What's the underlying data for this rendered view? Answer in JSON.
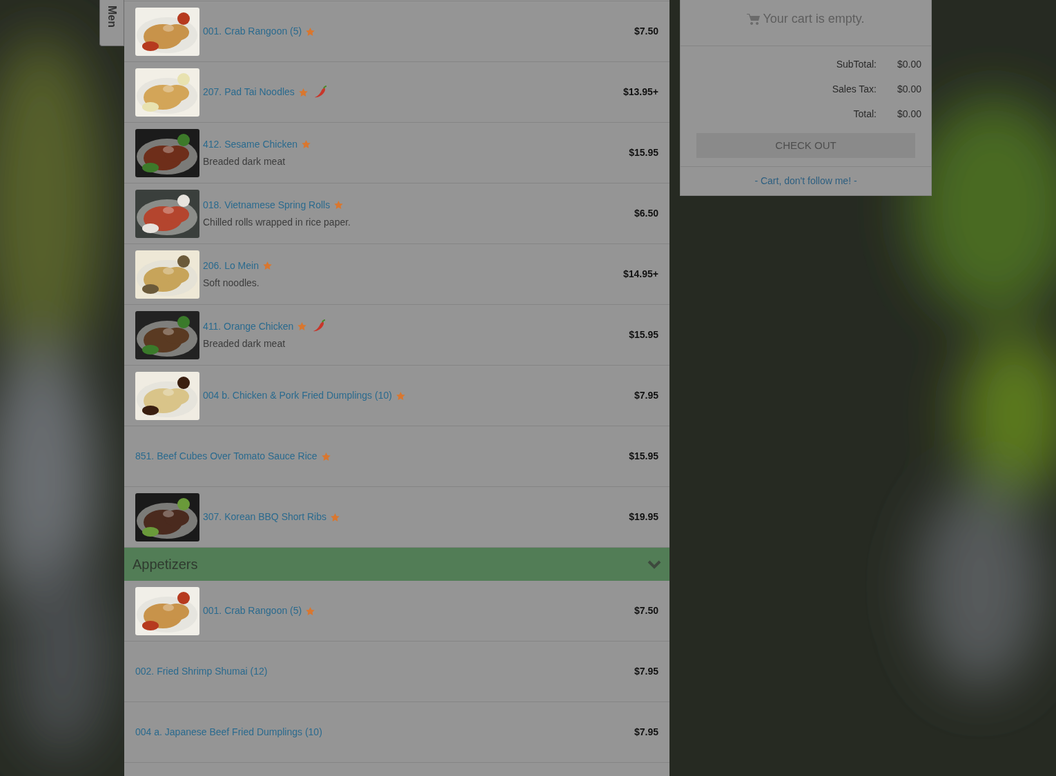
{
  "side_tab": {
    "label": "Men"
  },
  "menu_items": [
    {
      "name": "001. Crab Rangoon (5)",
      "price": "$7.50",
      "starred": true,
      "spicy": false,
      "has_photo": true
    },
    {
      "name": "207. Pad Tai Noodles",
      "price": "$13.95+",
      "starred": true,
      "spicy": true,
      "has_photo": true
    },
    {
      "name": "412. Sesame Chicken",
      "description": "Breaded dark meat",
      "price": "$15.95",
      "starred": true,
      "spicy": false,
      "has_photo": true
    },
    {
      "name": "018. Vietnamese Spring Rolls",
      "description": "Chilled rolls wrapped in rice paper.",
      "price": "$6.50",
      "starred": true,
      "spicy": false,
      "has_photo": true
    },
    {
      "name": "206. Lo Mein",
      "description": "Soft noodles.",
      "price": "$14.95+",
      "starred": true,
      "spicy": false,
      "has_photo": true
    },
    {
      "name": "411. Orange Chicken",
      "description": "Breaded dark meat",
      "price": "$15.95",
      "starred": true,
      "spicy": true,
      "has_photo": true
    },
    {
      "name": "004 b. Chicken & Pork Fried Dumplings (10)",
      "price": "$7.95",
      "starred": true,
      "spicy": false,
      "has_photo": true
    },
    {
      "name": "851. Beef Cubes Over Tomato Sauce Rice",
      "price": "$15.95",
      "starred": true,
      "spicy": false,
      "has_photo": false
    },
    {
      "name": "307. Korean BBQ Short Ribs",
      "price": "$19.95",
      "starred": true,
      "spicy": false,
      "has_photo": true
    }
  ],
  "category": {
    "title": "Appetizers",
    "expanded": true,
    "items": [
      {
        "name": "001. Crab Rangoon (5)",
        "price": "$7.50",
        "starred": true,
        "spicy": false,
        "has_photo": true
      },
      {
        "name": "002. Fried Shrimp Shumai (12)",
        "price": "$7.95",
        "starred": false,
        "spicy": false,
        "has_photo": false
      },
      {
        "name": "004 a. Japanese Beef Fried Dumplings (10)",
        "price": "$7.95",
        "starred": false,
        "spicy": false,
        "has_photo": false
      }
    ]
  },
  "cart": {
    "empty_message": "Your cart is empty.",
    "totals": [
      {
        "label": "SubTotal:",
        "value": "$0.00"
      },
      {
        "label": "Sales Tax:",
        "value": "$0.00"
      },
      {
        "label": "Total:",
        "value": "$0.00"
      }
    ],
    "checkout_button": {
      "label": "CHECK OUT",
      "disabled": true
    },
    "unfollow_link": "- Cart, don't follow me! -"
  }
}
